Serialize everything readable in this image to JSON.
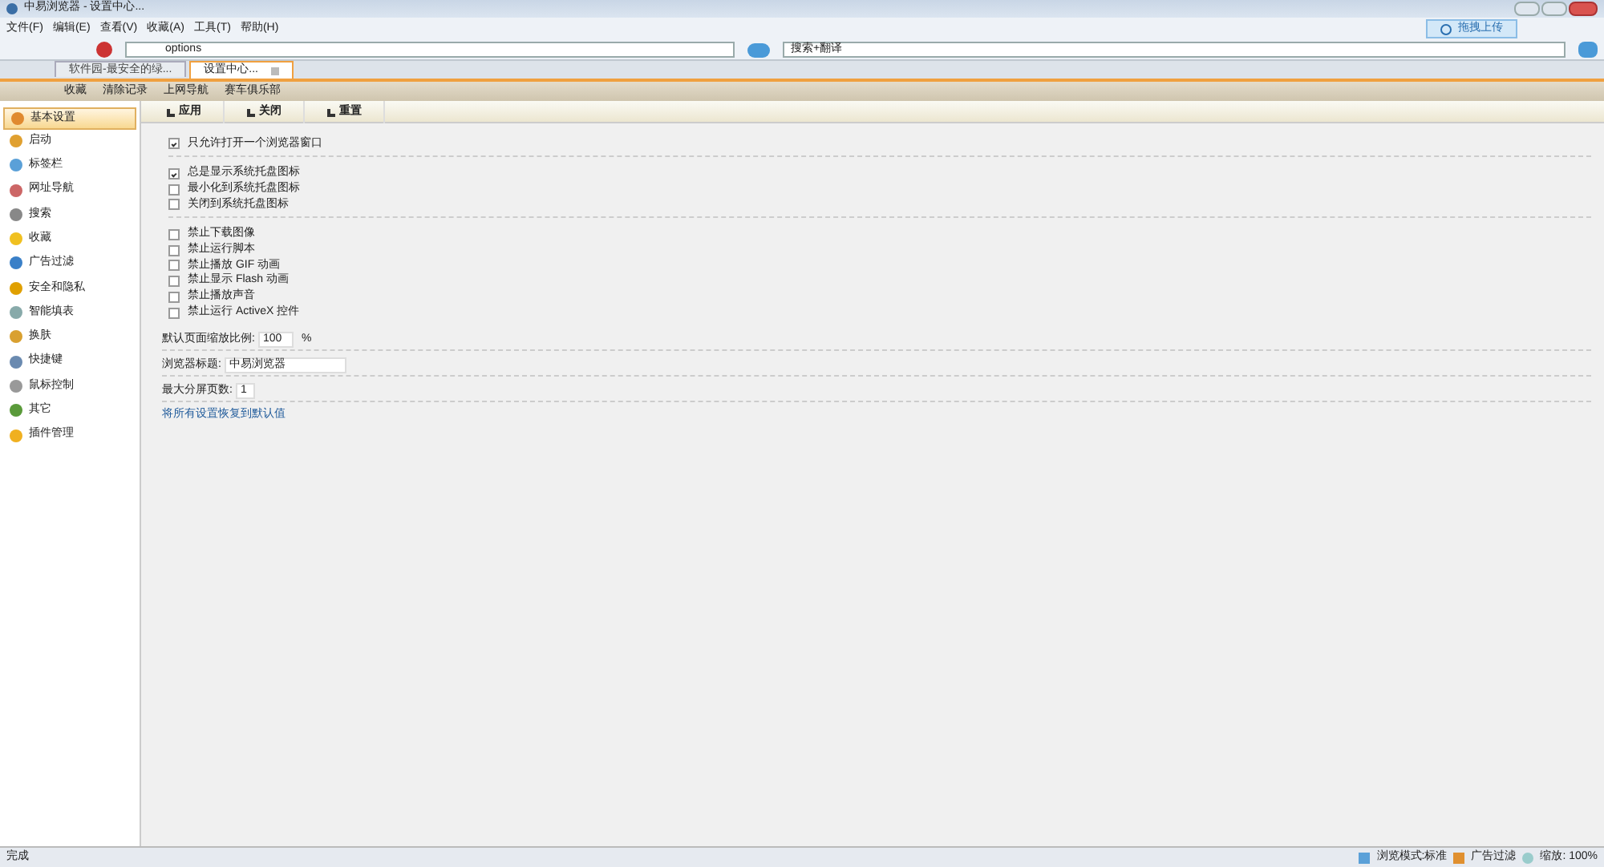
{
  "window": {
    "title": "中易浏览器 - 设置中心..."
  },
  "menu": [
    "文件(F)",
    "编辑(E)",
    "查看(V)",
    "收藏(A)",
    "工具(T)",
    "帮助(H)"
  ],
  "upload_button": "拖拽上传",
  "address": {
    "value": "options"
  },
  "search": {
    "value": "搜索+翻译"
  },
  "tabs": [
    {
      "label": "软件园-最安全的绿...",
      "selected": false
    },
    {
      "label": "设置中心...",
      "selected": true
    }
  ],
  "bookmarks": [
    "收藏",
    "清除记录",
    "上网导航",
    "赛车俱乐部"
  ],
  "sidebar": [
    {
      "label": "基本设置",
      "selected": true
    },
    {
      "label": "启动",
      "selected": false
    },
    {
      "label": "标签栏",
      "selected": false
    },
    {
      "label": "网址导航",
      "selected": false
    },
    {
      "label": "搜索",
      "selected": false
    },
    {
      "label": "收藏",
      "selected": false
    },
    {
      "label": "广告过滤",
      "selected": false
    },
    {
      "label": "安全和隐私",
      "selected": false
    },
    {
      "label": "智能填表",
      "selected": false
    },
    {
      "label": "换肤",
      "selected": false
    },
    {
      "label": "快捷键",
      "selected": false
    },
    {
      "label": "鼠标控制",
      "selected": false
    },
    {
      "label": "其它",
      "selected": false
    },
    {
      "label": "插件管理",
      "selected": false
    }
  ],
  "actions": [
    "应用",
    "关闭",
    "重置"
  ],
  "option_groups": [
    [
      {
        "label": "只允许打开一个浏览器窗口",
        "checked": true
      }
    ],
    [
      {
        "label": "总是显示系统托盘图标",
        "checked": true
      },
      {
        "label": "最小化到系统托盘图标",
        "checked": false
      },
      {
        "label": "关闭到系统托盘图标",
        "checked": false
      }
    ],
    [
      {
        "label": "禁止下载图像",
        "checked": false
      },
      {
        "label": "禁止运行脚本",
        "checked": false
      },
      {
        "label": "禁止播放 GIF 动画",
        "checked": false
      },
      {
        "label": "禁止显示 Flash 动画",
        "checked": false
      },
      {
        "label": "禁止播放声音",
        "checked": false
      },
      {
        "label": "禁止运行 ActiveX 控件",
        "checked": false
      }
    ]
  ],
  "zoom_field": {
    "label": "默认页面缩放比例:",
    "value": "100",
    "unit": "%"
  },
  "title_field": {
    "label": "浏览器标题:",
    "value": "中易浏览器"
  },
  "pages_field": {
    "label": "最大分屏页数:",
    "value": "1"
  },
  "reset_link": "将所有设置恢复到默认值",
  "status_bar": {
    "text": "完成",
    "mode": "浏览模式:标准",
    "adblock": "广告过滤",
    "zoom": "缩放: 100%"
  }
}
